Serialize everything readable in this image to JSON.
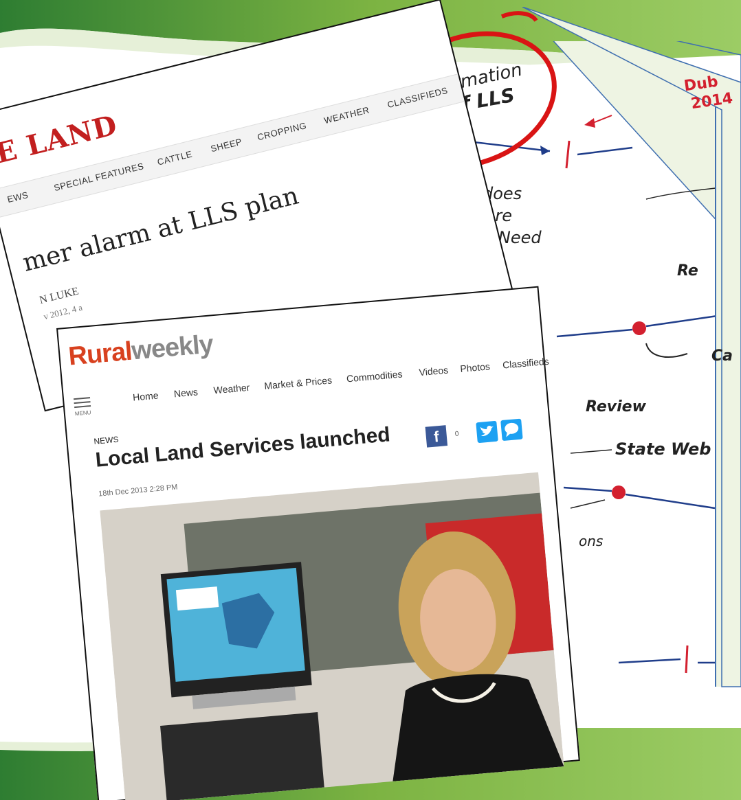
{
  "sketch": {
    "formation": "Formation",
    "of_lls": "of LLS",
    "what_does": "hat does",
    "landcare": "ndcare",
    "really_need": "ally Need",
    "re": "Re",
    "ca": "Ca",
    "review": "Review",
    "state_web": "State Web",
    "ons": "ons",
    "dub": "Dub",
    "year": "2014"
  },
  "land": {
    "logo": "E LAND",
    "nav": [
      "EWS",
      "SPECIAL FEATURES",
      "CATTLE",
      "SHEEP",
      "CROPPING",
      "WEATHER",
      "CLASSIFIEDS"
    ],
    "headline": "mer alarm at LLS plan",
    "byline": "N LUKE",
    "date": "v 2012, 4 a"
  },
  "rural": {
    "logo_a": "Rural",
    "logo_b": "weekly",
    "menu_label": "MENU",
    "nav": [
      "Home",
      "News",
      "Weather",
      "Market & Prices",
      "Commodities",
      "Videos",
      "Photos",
      "Classifieds"
    ],
    "section": "NEWS",
    "headline": "Local Land Services launched",
    "date": "18th Dec 2013 2:28 PM",
    "fb_count": "0"
  },
  "colors": {
    "green": "#7cb342",
    "red_circle": "#d91414",
    "timeline": "#1f3d8a",
    "dot": "#d3202f"
  }
}
